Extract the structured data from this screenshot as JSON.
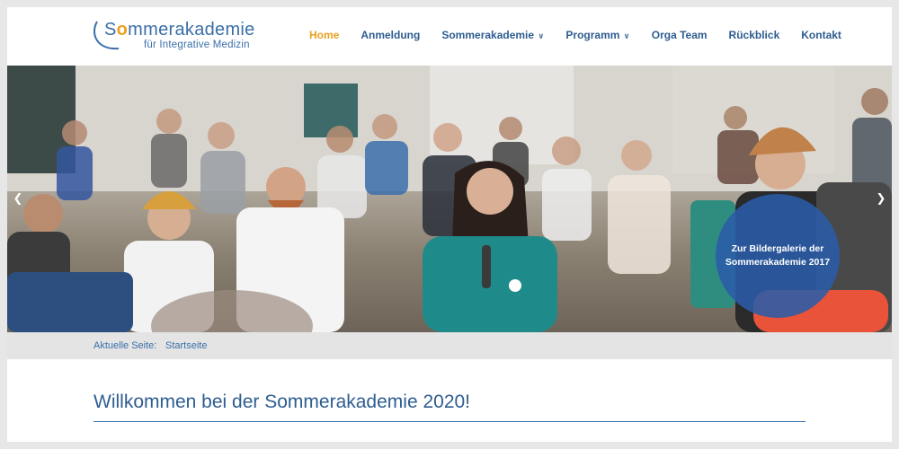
{
  "logo": {
    "name_prefix": "S",
    "name_accent": "o",
    "name_rest": "mmerakademie",
    "subtitle": "für Integrative Medizin"
  },
  "nav": {
    "items": [
      {
        "label": "Home",
        "active": true,
        "dropdown": false
      },
      {
        "label": "Anmeldung",
        "active": false,
        "dropdown": false
      },
      {
        "label": "Sommerakademie",
        "active": false,
        "dropdown": true
      },
      {
        "label": "Programm",
        "active": false,
        "dropdown": true
      },
      {
        "label": "Orga Team",
        "active": false,
        "dropdown": false
      },
      {
        "label": "Rückblick",
        "active": false,
        "dropdown": false
      },
      {
        "label": "Kontakt",
        "active": false,
        "dropdown": false
      }
    ],
    "dropdown_icon": "chevron-down-icon"
  },
  "hero": {
    "prev_icon": "chevron-left-icon",
    "next_icon": "chevron-right-icon",
    "gallery_line1": "Zur Bildergalerie der",
    "gallery_line2": "Sommerakademie 2017"
  },
  "breadcrumb": {
    "label": "Aktuelle Seite:",
    "current": "Startseite"
  },
  "main": {
    "heading": "Willkommen bei der Sommerakademie 2020!"
  },
  "colors": {
    "brand_blue": "#2e5d90",
    "accent_orange": "#e8a020",
    "gallery_circle": "#2a5ca8",
    "breadcrumb_bg": "#e4e4e4"
  }
}
